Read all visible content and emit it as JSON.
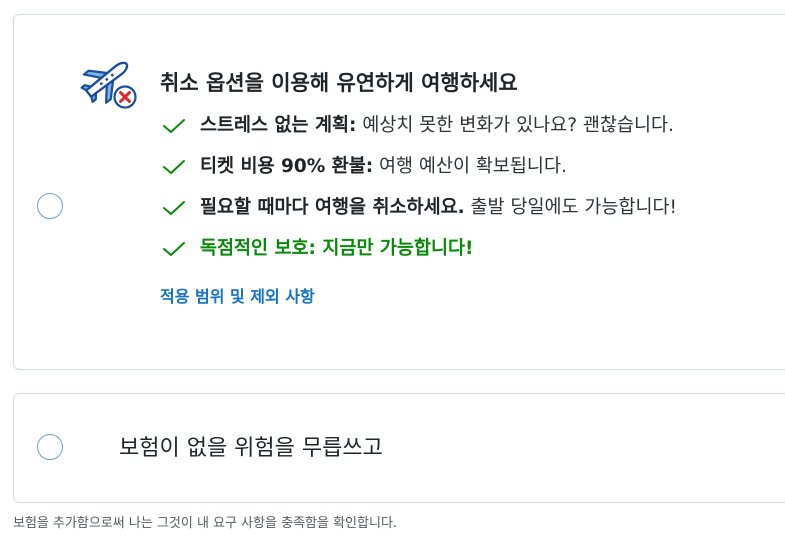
{
  "cancel_option": {
    "title": "취소 옵션을 이용해 유연하게 여행하세요",
    "benefits": [
      {
        "bold": "스트레스 없는 계획:",
        "text": " 예상치 못한 변화가 있나요? 괜찮습니다."
      },
      {
        "bold": "티켓 비용 90% 환불:",
        "text": " 여행 예산이 확보됩니다."
      },
      {
        "bold": "필요할 때마다 여행을 취소하세요.",
        "text": " 출발 당일에도 가능합니다!"
      },
      {
        "bold": "독점적인 보호: 지금만 가능합니다!",
        "text": ""
      }
    ],
    "terms_link": "적용 범위 및 제외 사항",
    "icon": "plane-cancel-icon",
    "check_color": "#0a8a0a",
    "exclusive_color": "#0a8a0a"
  },
  "decline_option": {
    "label": "보험이 없을 위험을 무릅쓰고"
  },
  "footnote": "보험을 추가함으로써 나는 그것이 내 요구 사항을 충족함을 확인합니다.",
  "colors": {
    "card_border": "#cfdde8",
    "radio_border": "#6b9fd4",
    "link": "#1272c4",
    "icon_blue": "#1a4f9c",
    "icon_light": "#7fb3ea",
    "icon_red": "#d9232e"
  }
}
